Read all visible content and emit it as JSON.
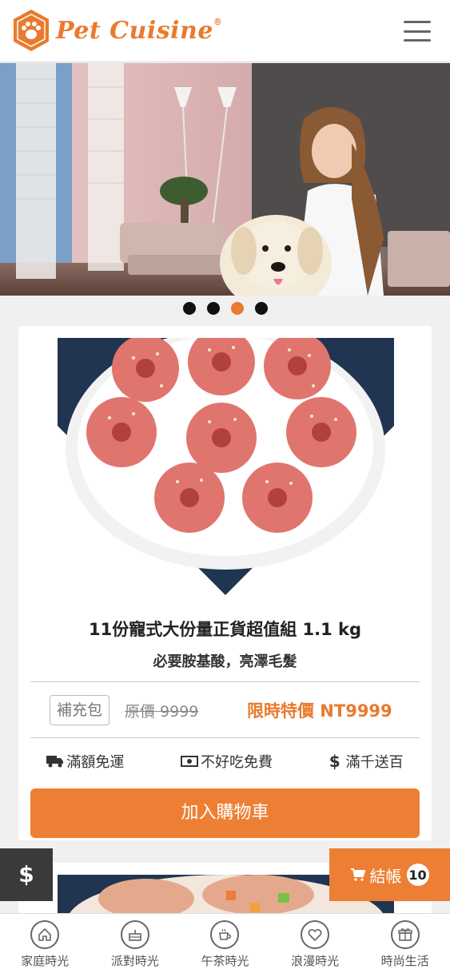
{
  "header": {
    "logo_text": "Pet Cuisine",
    "logo_mark": "®"
  },
  "carousel": {
    "dot_count": 4,
    "active_index": 2
  },
  "product": {
    "title": "11份寵式大份量正貨超值組 1.1 kg",
    "subtitle": "必要胺基酸，亮澤毛髮",
    "tag": "補充包",
    "original_price": "原價 9999",
    "sale_price": "限時特價 NT9999",
    "perks": [
      {
        "icon": "truck-icon",
        "label": "滿額免運"
      },
      {
        "icon": "money-icon",
        "label": "不好吃免費"
      },
      {
        "icon": "dollar-icon",
        "label": "滿千送百"
      }
    ],
    "add_to_cart": "加入購物車"
  },
  "floating": {
    "dollar_label": "$",
    "checkout_label": "結帳",
    "cart_count": "10"
  },
  "bottom_nav": [
    {
      "label": "家庭時光",
      "icon": "home-icon"
    },
    {
      "label": "派對時光",
      "icon": "cake-icon"
    },
    {
      "label": "午茶時光",
      "icon": "tea-icon"
    },
    {
      "label": "浪漫時光",
      "icon": "heart-icon"
    },
    {
      "label": "時尚生活",
      "icon": "gift-icon"
    }
  ],
  "colors": {
    "accent": "#e97a2e",
    "dark_button": "#3a3a3a"
  }
}
